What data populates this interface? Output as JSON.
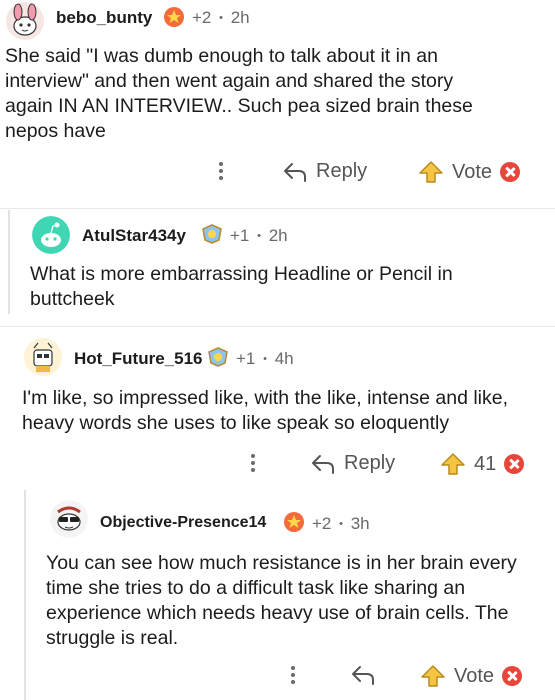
{
  "comments": [
    {
      "username": "bebo_bunty",
      "karma": "+2",
      "time": "2h",
      "body": "She said \"I was dumb enough to talk about it in an interview\" and then went again and shared the story again IN AN INTERVIEW.. Such pea sized brain these nepos have",
      "reply_label": "Reply",
      "vote_label": "Vote"
    },
    {
      "username": "AtulStar434y",
      "karma": "+1",
      "time": "2h",
      "body": "What is more embarrassing Headline or Pencil in buttcheek"
    },
    {
      "username": "Hot_Future_516",
      "karma": "+1",
      "time": "4h",
      "body": "I'm like, so impressed like, with the like, intense and like, heavy words she uses to like speak so eloquently",
      "reply_label": "Reply",
      "vote_label": "41"
    },
    {
      "username": "Objective-Presence14",
      "karma": "+2",
      "time": "3h",
      "body": "You can see how much resistance is in her brain every time she tries to do a difficult task like sharing an experience which needs heavy use of brain cells. The struggle is real.",
      "vote_label": "Vote"
    }
  ],
  "separator": "•",
  "colors": {
    "accent_yellow": "#f5c542",
    "downvote_red": "#e8463a",
    "meta_gray": "#6a6a6a"
  }
}
